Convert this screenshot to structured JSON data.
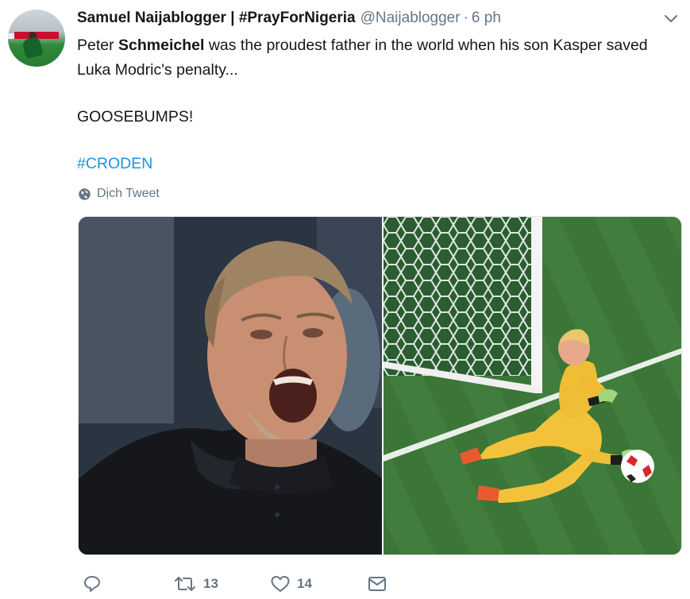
{
  "tweet": {
    "author_name": "Samuel Naijablogger | #PrayForNigeria",
    "handle": "@Naijablogger",
    "separator": "·",
    "time": "6 ph",
    "text_part1": "Peter ",
    "text_bold": "Schmeichel",
    "text_part2": " was the proudest father in the world when his son Kasper saved Luka Modric's penalty...",
    "text_line2": "GOOSEBUMPS!",
    "hashtag": "#CRODEN",
    "translate_label": "Dịch Tweet"
  },
  "actions": {
    "reply_count": "",
    "retweet_count": "13",
    "like_count": "14"
  },
  "colors": {
    "text": "#14171a",
    "secondary": "#657786",
    "link": "#1b95e0"
  },
  "icons": {
    "caret": "chevron-down-icon",
    "translate": "globe-icon",
    "reply": "reply-icon",
    "retweet": "retweet-icon",
    "like": "heart-icon",
    "dm": "envelope-icon"
  }
}
